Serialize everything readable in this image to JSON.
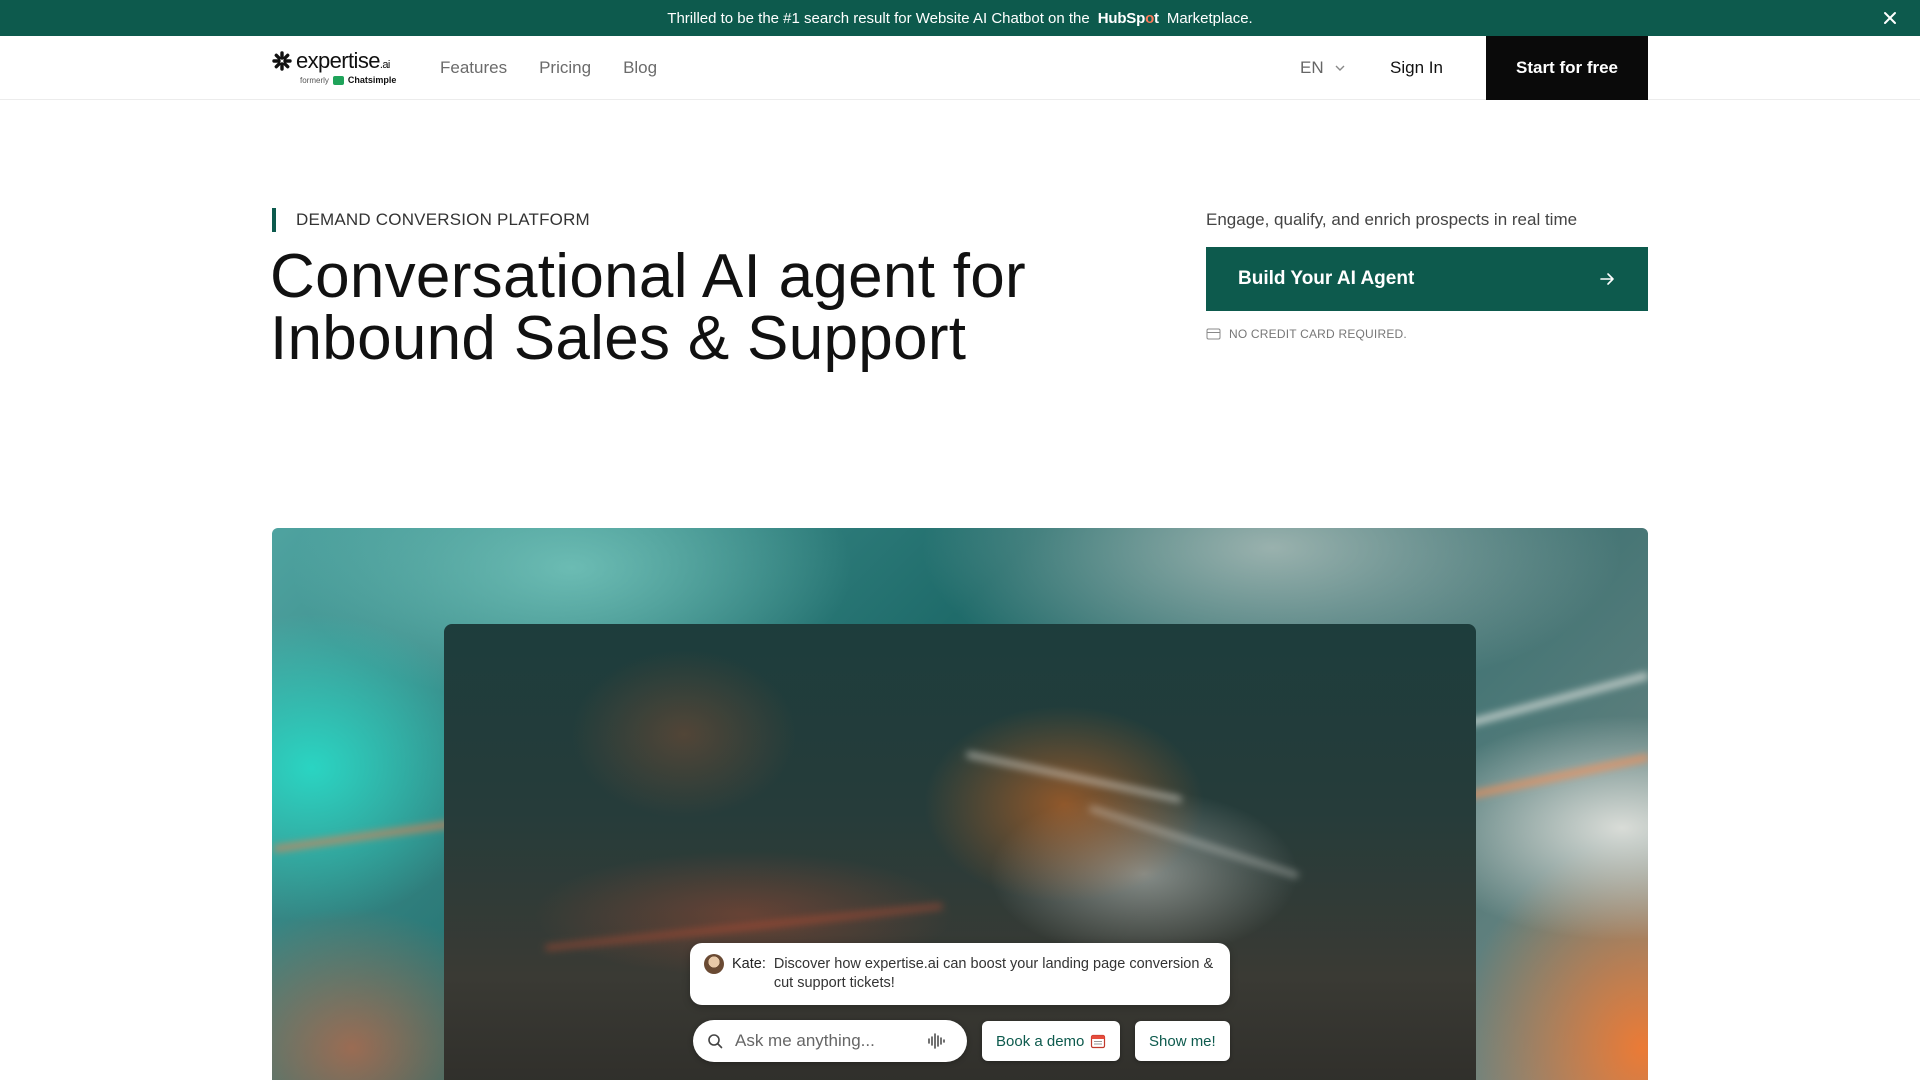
{
  "announcement": {
    "text_before": "Thrilled to be the #1 search result for Website AI Chatbot on the",
    "hubspot_a": "HubSp",
    "hubspot_o": "o",
    "hubspot_b": "t",
    "text_after": "Marketplace.",
    "close_icon": "close-icon"
  },
  "nav": {
    "logo_word": "expertise",
    "logo_suffix": ".ai",
    "logo_formerly": "formerly",
    "logo_former_name": "Chatsimple",
    "links": [
      "Features",
      "Pricing",
      "Blog"
    ],
    "language": "EN",
    "sign_in": "Sign In",
    "start": "Start for free"
  },
  "hero": {
    "eyebrow": "DEMAND CONVERSION PLATFORM",
    "headline_line1": "Conversational AI agent for",
    "headline_line2": "Inbound Sales & Support",
    "tagline": "Engage, qualify, and enrich prospects in real time",
    "cta_label": "Build Your AI Agent",
    "no_credit": "NO CREDIT CARD REQUIRED."
  },
  "chat_widget": {
    "agent_name": "Kate:",
    "message": "Discover how expertise.ai can boost your landing page conversion & cut support tickets!",
    "input_placeholder": "Ask me anything...",
    "chips": [
      "Book a demo",
      "Show me!"
    ]
  },
  "colors": {
    "brand_green": "#0d5a4d",
    "cta_black": "#0a0a0a",
    "hubspot_orange": "#ff7a59"
  }
}
